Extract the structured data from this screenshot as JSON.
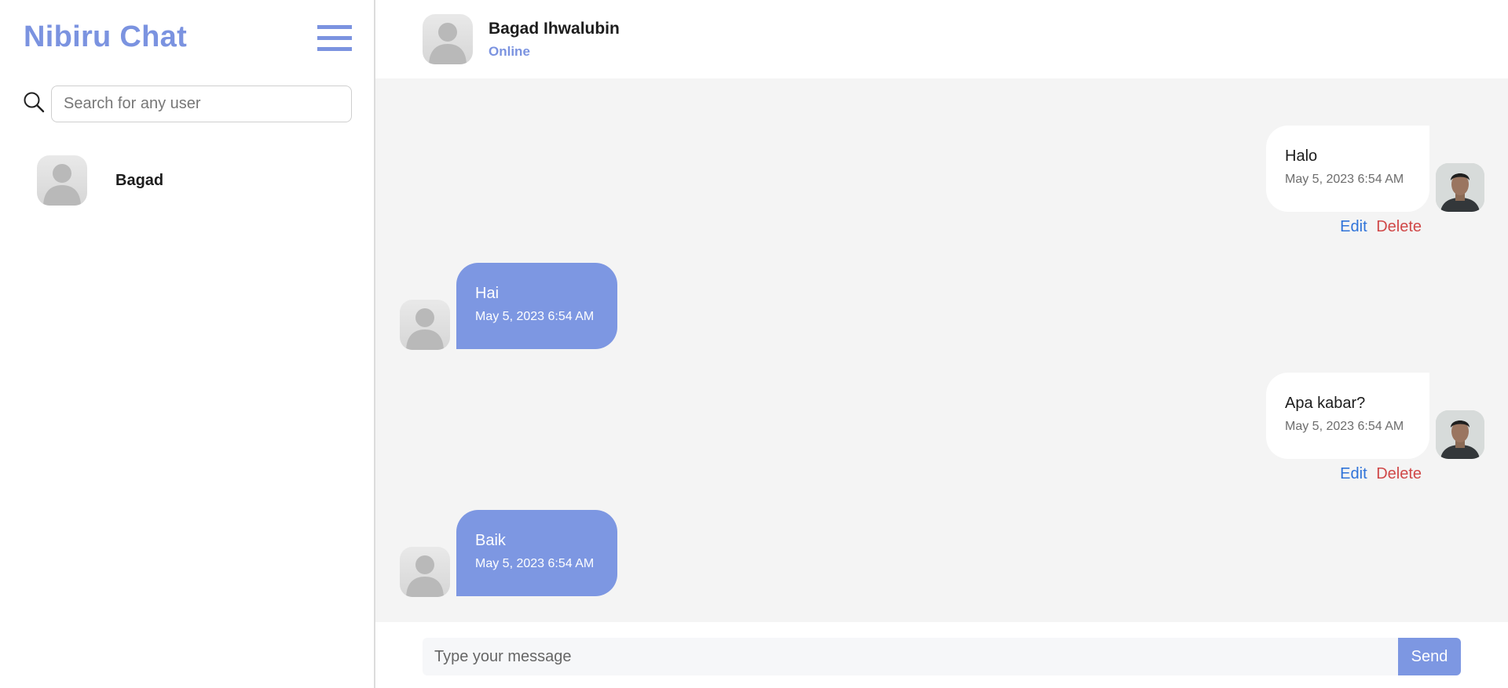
{
  "sidebar": {
    "brand": "Nibiru Chat",
    "search_placeholder": "Search for any user",
    "users": [
      {
        "name": "Bagad"
      }
    ]
  },
  "header": {
    "name": "Bagad Ihwalubin",
    "status": "Online"
  },
  "messages": [
    {
      "direction": "outgoing",
      "text": "Halo",
      "time": "May 5, 2023 6:54 AM",
      "edit_label": "Edit",
      "delete_label": "Delete"
    },
    {
      "direction": "incoming",
      "text": "Hai",
      "time": "May 5, 2023 6:54 AM"
    },
    {
      "direction": "outgoing",
      "text": "Apa kabar?",
      "time": "May 5, 2023 6:54 AM",
      "edit_label": "Edit",
      "delete_label": "Delete"
    },
    {
      "direction": "incoming",
      "text": "Baik",
      "time": "May 5, 2023 6:54 AM"
    }
  ],
  "composer": {
    "placeholder": "Type your message",
    "send_label": "Send"
  },
  "colors": {
    "accent": "#7b93e0",
    "incoming_bubble": "#7d97e2",
    "chat_background": "#f4f4f4",
    "edit": "#2f73d9",
    "delete": "#d04848"
  },
  "icons": [
    "menu-icon",
    "search-icon",
    "default-avatar-icon",
    "user-photo-avatar"
  ]
}
